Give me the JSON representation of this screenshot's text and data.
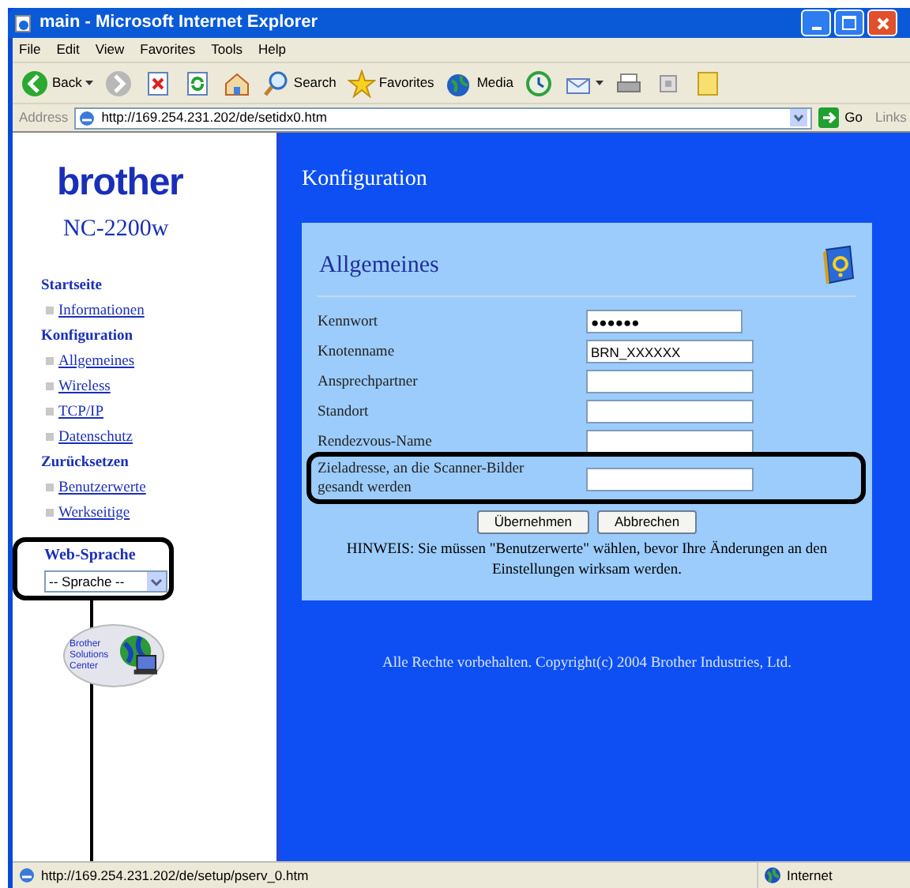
{
  "window": {
    "title": "main - Microsoft Internet Explorer"
  },
  "menu": [
    "File",
    "Edit",
    "View",
    "Favorites",
    "Tools",
    "Help"
  ],
  "toolbar": [
    {
      "kind": "back",
      "label": "Back"
    },
    {
      "kind": "forward"
    },
    {
      "kind": "stop"
    },
    {
      "kind": "refresh"
    },
    {
      "kind": "home"
    },
    {
      "kind": "search",
      "label": "Search"
    },
    {
      "kind": "favorites",
      "label": "Favorites"
    },
    {
      "kind": "media",
      "label": "Media"
    },
    {
      "kind": "history"
    },
    {
      "kind": "mail"
    },
    {
      "kind": "print"
    },
    {
      "kind": "edit"
    },
    {
      "kind": "notes"
    }
  ],
  "address_bar": {
    "label": "Address",
    "value": "http://169.254.231.202/de/setidx0.htm",
    "go": "Go",
    "links": "Links"
  },
  "sidebar": {
    "logo": "brother",
    "model": "NC-2200w",
    "sections": [
      {
        "title": "Startseite",
        "items": [
          "Informationen"
        ]
      },
      {
        "title": "Konfiguration",
        "items": [
          "Allgemeines",
          "Wireless",
          "TCP/IP",
          "Datenschutz"
        ]
      },
      {
        "title": "Zurücksetzen",
        "items": [
          "Benutzerwerte",
          "Werkseitige"
        ]
      }
    ],
    "language": {
      "title": "Web-Sprache",
      "value": "-- Sprache --"
    },
    "solutions_center": "Brother Solutions Center"
  },
  "main": {
    "heading": "Konfiguration",
    "panel": {
      "title": "Allgemeines",
      "fields": [
        {
          "label": "Kennwort",
          "value": "●●●●●●",
          "highlighted": false
        },
        {
          "label": "Knotenname",
          "value": "BRN_XXXXXX",
          "highlighted": false
        },
        {
          "label": "Ansprechpartner",
          "highlighted": false
        },
        {
          "label": "Standort",
          "highlighted": false
        },
        {
          "label": "Rendezvous-Name",
          "highlighted": false
        },
        {
          "label": "Zieladresse, an die Scanner-Bilder gesandt werden",
          "highlighted": true
        }
      ],
      "buttons": [
        "Übernehmen",
        "Abbrechen"
      ],
      "note": "HINWEIS: Sie müssen \"Benutzerwerte\" wählen, bevor Ihre Änderungen an den Einstellungen wirksam werden."
    },
    "footer": "Alle Rechte vorbehalten. Copyright(c) 2004 Brother Industries, Ltd."
  },
  "status_bar": {
    "url": "http://169.254.231.202/de/setup/pserv_0.htm",
    "zone": "Internet"
  }
}
